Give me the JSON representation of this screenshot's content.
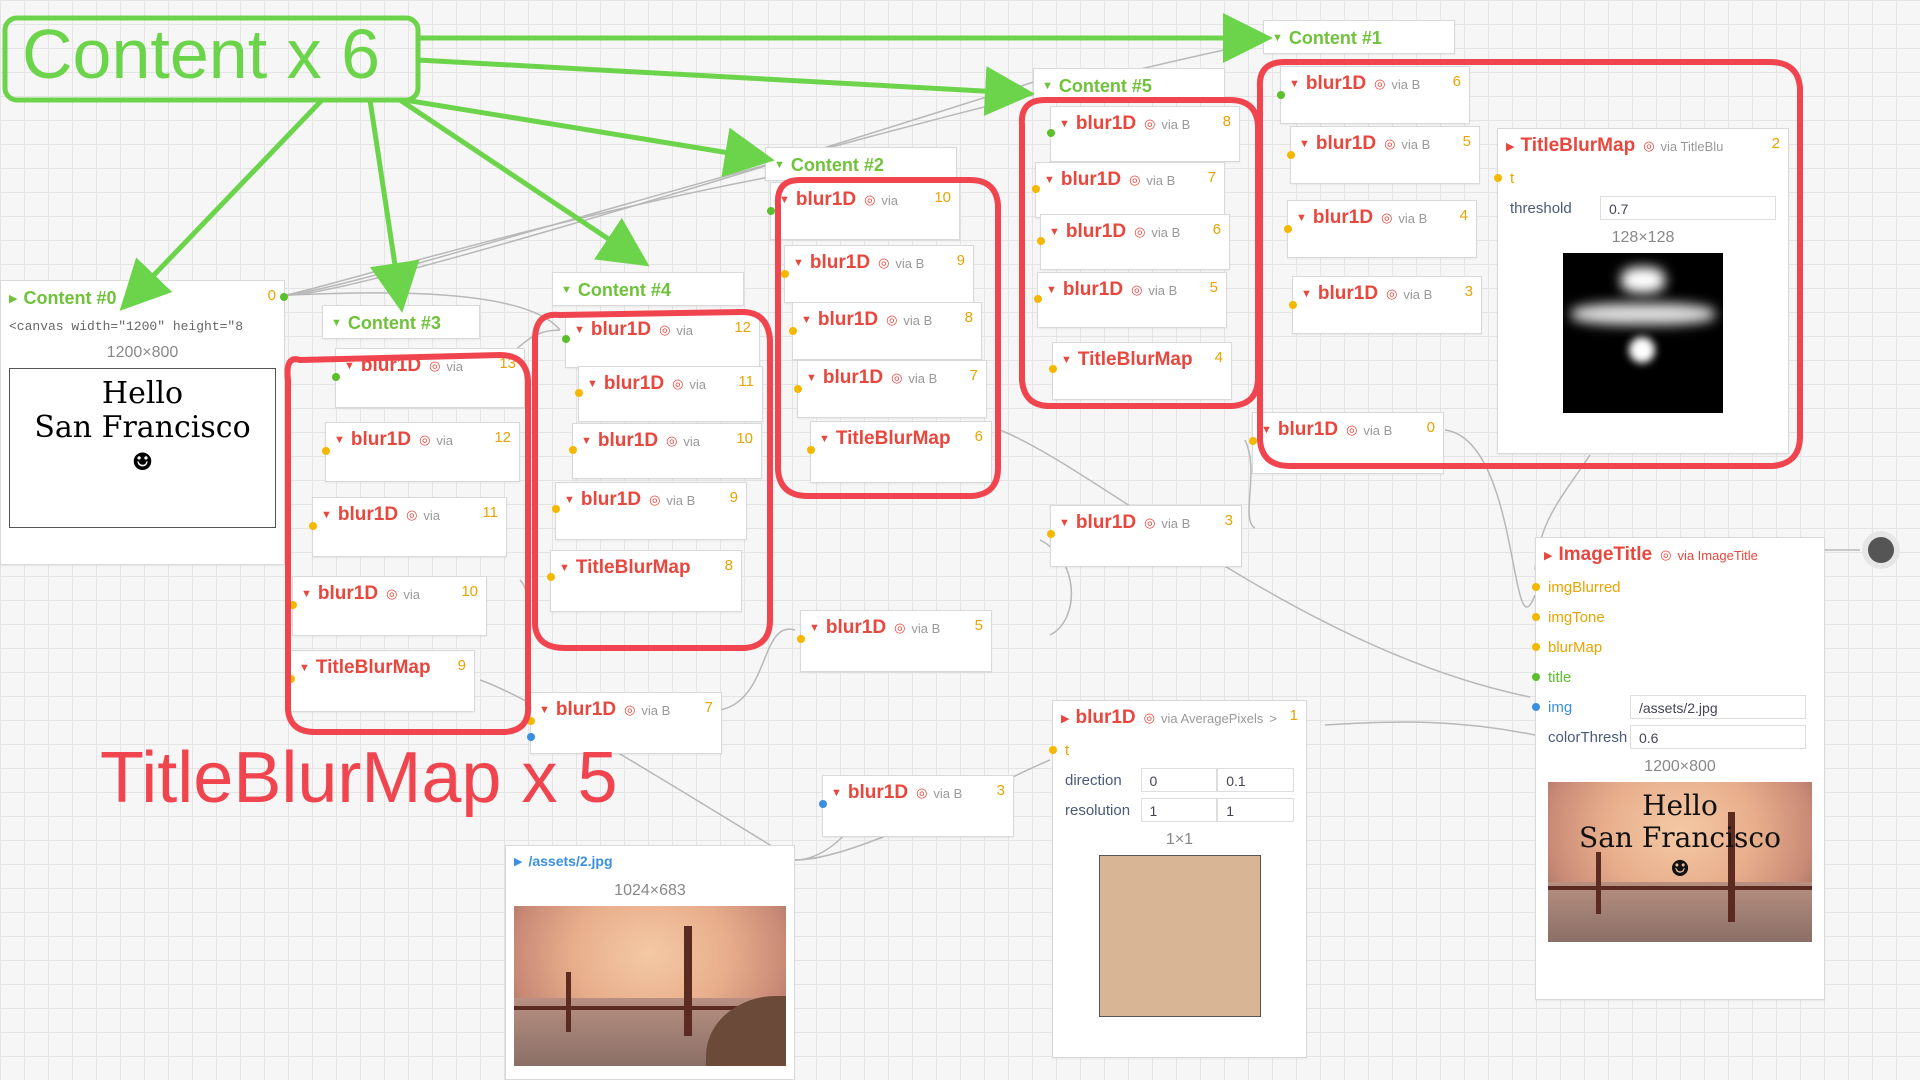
{
  "annotations": {
    "content_count": "Content x 6",
    "titleblurmap_count": "TitleBlurMap x 5"
  },
  "content_nodes": {
    "c0": {
      "title": "Content #0",
      "out": "0",
      "code": "<canvas width=\"1200\" height=\"8",
      "dims": "1200×800",
      "preview_line1": "Hello",
      "preview_line2": "San Francisco",
      "preview_icon": "☻"
    },
    "c1": {
      "title": "Content #1"
    },
    "c2": {
      "title": "Content #2"
    },
    "c3": {
      "title": "Content #3"
    },
    "c4": {
      "title": "Content #4"
    },
    "c5": {
      "title": "Content #5"
    }
  },
  "labels": {
    "blur": "blur1D",
    "tbm": "TitleBlurMap",
    "via": "via",
    "via_b": "via B",
    "via_titleblu": "via TitleBlu",
    "via_avg": "via AveragePixels",
    "via_imagetitle": "via ImageTitle",
    "avg_marker": ">",
    "image_title": "ImageTitle"
  },
  "nodes_out": {
    "g3a": "13",
    "g3b": "12",
    "g3c": "11",
    "g3d": "10",
    "g3e": "9",
    "g4a": "12",
    "g4b": "11",
    "g4c": "10",
    "g4d": "9",
    "g4e": "8",
    "g2a": "10",
    "g2b": "9",
    "g2c": "8",
    "g2d": "7",
    "g2e": "6",
    "g5a": "8",
    "g5b": "7",
    "g5c": "6",
    "g5d": "5",
    "g5e": "4",
    "g1a": "6",
    "g1b": "5",
    "g1c": "4",
    "g1d": "3",
    "tbm2": "2",
    "b0": "0",
    "b3": "3",
    "b5": "5",
    "b7": "7",
    "b3low": "3",
    "avg": "1"
  },
  "titleblurmap_detail": {
    "port_t": "t",
    "threshold_label": "threshold",
    "threshold_value": "0.7",
    "dims": "128×128"
  },
  "avg_node": {
    "port_t": "t",
    "direction_label": "direction",
    "direction_values": [
      "0",
      "0.1"
    ],
    "resolution_label": "resolution",
    "resolution_values": [
      "1",
      "1"
    ],
    "dims": "1×1",
    "swatch_color": "#d8b595"
  },
  "image_title": {
    "ports": [
      "imgBlurred",
      "imgTone",
      "blurMap",
      "title",
      "img",
      "colorThresh"
    ],
    "img_value": "/assets/2.jpg",
    "color_thresh_value": "0.6",
    "dims": "1200×800",
    "preview_line1": "Hello",
    "preview_line2": "San Francisco",
    "preview_icon": "☻"
  },
  "asset_node": {
    "path": "/assets/2.jpg",
    "dims": "1024×683"
  },
  "colors": {
    "annotation_green": "#6cd44a",
    "annotation_red": "#f0454f",
    "content_green": "#6fc23a",
    "node_red": "#e8473e",
    "port_yellow": "#f5b800"
  }
}
